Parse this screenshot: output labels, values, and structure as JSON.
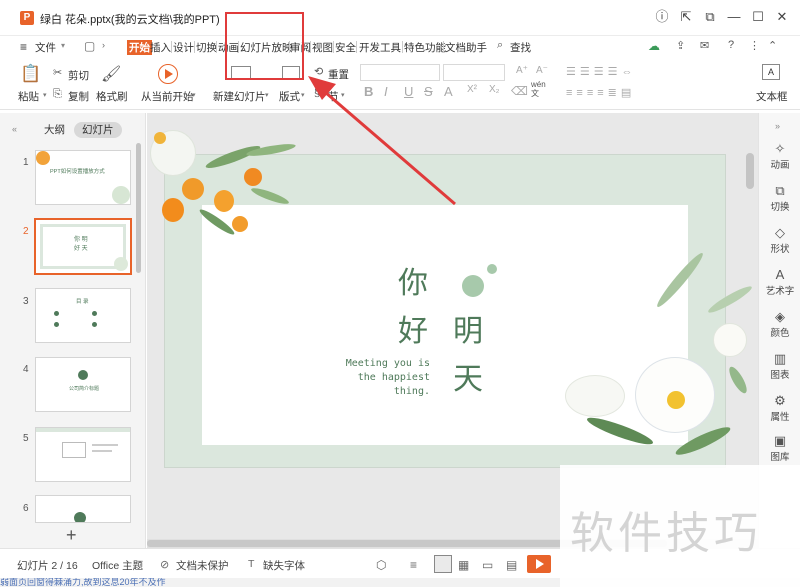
{
  "window": {
    "title": "绿白 花朵.pptx(我的云文档\\我的PPT)",
    "app_icon": "P"
  },
  "menu": {
    "file": "文件",
    "tabs": [
      "开始",
      "插入",
      "设计",
      "切换",
      "动画",
      "幻灯片放映",
      "审阅",
      "视图",
      "安全",
      "开发工具",
      "特色功能",
      "文档助手"
    ],
    "search": "查找"
  },
  "ribbon": {
    "paste": "粘贴",
    "cut": "剪切",
    "copy": "复制",
    "format_painter": "格式刷",
    "from_current": "从当前开始",
    "new_slide": "新建幻灯片",
    "layout": "版式",
    "reset": "重置",
    "section": "节",
    "textbox": "文本框",
    "wen": "wén\n文"
  },
  "left_panel": {
    "tab_outline": "大纲",
    "tab_slides": "幻灯片",
    "thumbs": [
      {
        "num": "1",
        "text": "PPT如何设置播放方式"
      },
      {
        "num": "2",
        "text": "你 明\n好 天"
      },
      {
        "num": "3",
        "text": "目 录"
      },
      {
        "num": "4",
        "text": "公司简介标题"
      },
      {
        "num": "5",
        "text": ""
      },
      {
        "num": "6",
        "text": ""
      }
    ],
    "add": "+"
  },
  "slide": {
    "line1a": "你",
    "line1b": "好",
    "line2a": "明",
    "line2b": "天",
    "subtitle_1": "Meeting you is",
    "subtitle_2": "the happiest",
    "subtitle_3": "thing."
  },
  "right_panel": {
    "items": [
      "动画",
      "切换",
      "形状",
      "艺术字",
      "颜色",
      "图表",
      "属性",
      "图库"
    ]
  },
  "status": {
    "slide_count": "幻灯片 2 / 16",
    "theme": "Office 主题",
    "protect": "文档未保护",
    "missing_font": "缺失字体"
  },
  "watermark": "软件技巧",
  "bottom_text": "弱面页回窗得棘涌力,故到这息20年不及作",
  "colors": {
    "accent": "#e8632a",
    "highlight_box": "#e03b3b",
    "slide_green": "#4f7a5a"
  }
}
